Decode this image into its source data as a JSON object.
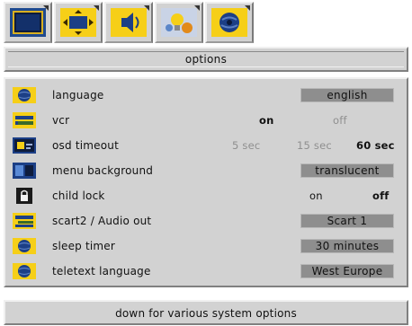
{
  "header": {
    "tabs": [
      {
        "icon": "tv-screen-icon"
      },
      {
        "icon": "screen-adjust-icon"
      },
      {
        "icon": "speaker-icon"
      },
      {
        "icon": "lightbulb-settings-icon"
      },
      {
        "icon": "globe-options-icon"
      }
    ],
    "title": "options"
  },
  "options": {
    "language": {
      "label": "language",
      "value": "english"
    },
    "vcr": {
      "label": "vcr",
      "on": "on",
      "off": "off",
      "selected": "on"
    },
    "osd_timeout": {
      "label": "osd timeout",
      "opt1": "5 sec",
      "opt2": "15 sec",
      "opt3": "60 sec",
      "selected": "60 sec"
    },
    "menu_background": {
      "label": "menu background",
      "value": "translucent"
    },
    "child_lock": {
      "label": "child lock",
      "on": "on",
      "off": "off",
      "selected": "off"
    },
    "scart2": {
      "label": "scart2 / Audio out",
      "value": "Scart 1"
    },
    "sleep_timer": {
      "label": "sleep timer",
      "value": "30  minutes"
    },
    "teletext_language": {
      "label": "teletext language",
      "value": "West Europe"
    }
  },
  "footer": {
    "hint": "down for various system options"
  },
  "colors": {
    "accent_yellow": "#f6cf18",
    "icon_blue": "#1c3f86",
    "panel_gray": "#d2d2d2",
    "value_box": "#8e8e8e"
  }
}
